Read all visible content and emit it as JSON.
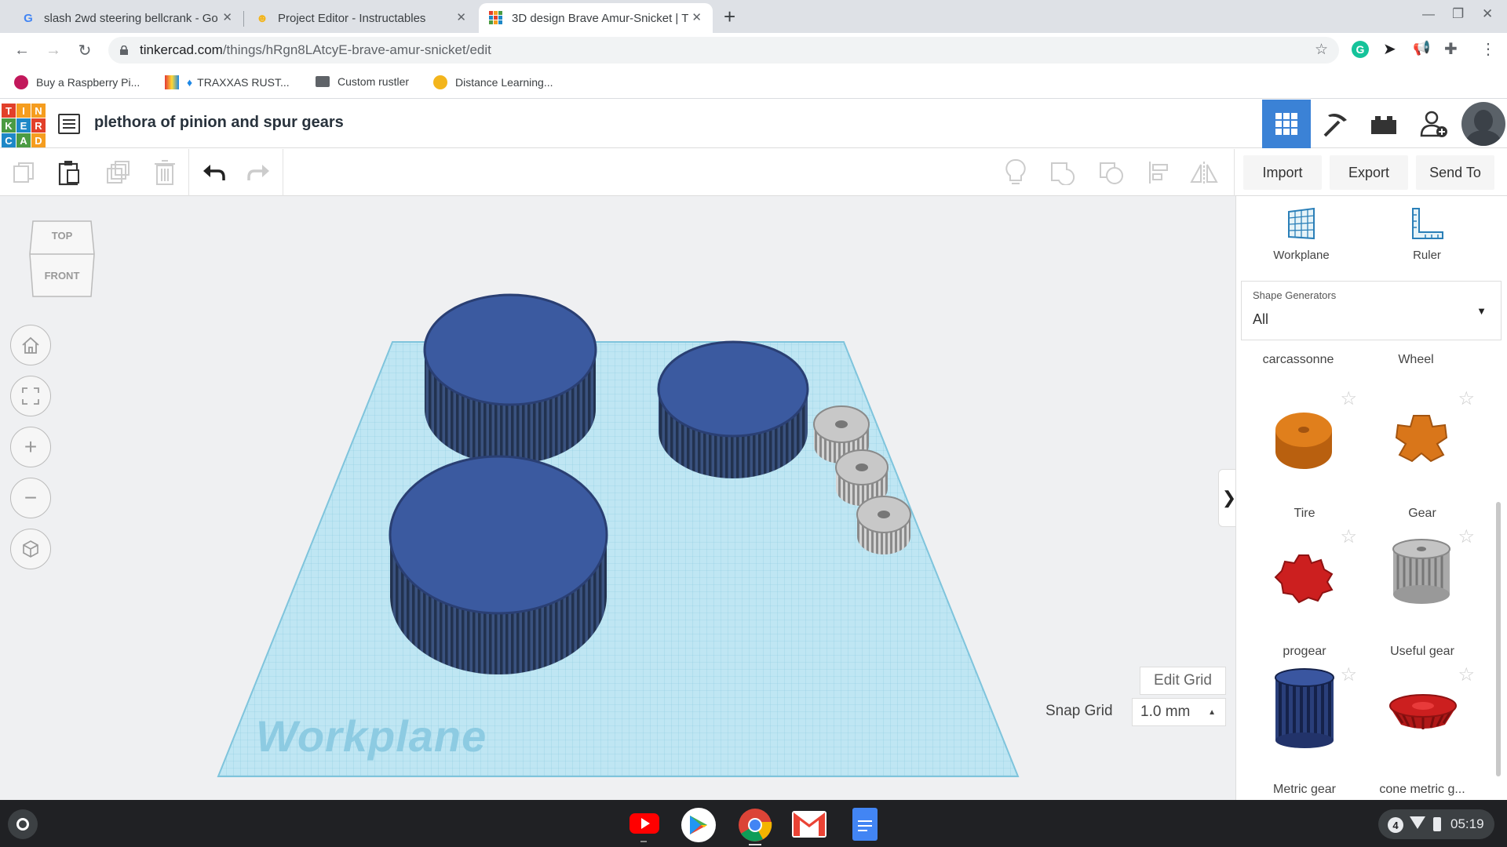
{
  "browser": {
    "tabs": [
      {
        "title": "slash 2wd steering bellcrank - Go",
        "icon": "google-icon"
      },
      {
        "title": "Project Editor - Instructables",
        "icon": "instructables-icon"
      },
      {
        "title": "3D design Brave Amur-Snicket | T",
        "icon": "tinkercad-icon",
        "active": true
      }
    ],
    "new_tab_glyph": "+",
    "url_domain": "tinkercad.com",
    "url_path": "/things/hRgn8LAtcyE-brave-amur-snicket/edit",
    "bookmarks": [
      {
        "label": "Buy a Raspberry Pi..."
      },
      {
        "label": "TRAXXAS RUST..."
      },
      {
        "label": "Custom rustler"
      },
      {
        "label": "Distance Learning..."
      }
    ]
  },
  "app": {
    "logo_letters": [
      "T",
      "I",
      "N",
      "K",
      "E",
      "R",
      "C",
      "A",
      "D"
    ],
    "logo_colors": [
      "#e2402a",
      "#f59d1f",
      "#f59d1f",
      "#4b9b43",
      "#1e88c7",
      "#e2402a",
      "#1e88c7",
      "#4b9b43",
      "#f59d1f"
    ],
    "design_title": "plethora of pinion and spur gears",
    "toolbar": {
      "import_label": "Import",
      "export_label": "Export",
      "send_to_label": "Send To"
    }
  },
  "viewport": {
    "view_cube_top": "TOP",
    "view_cube_front": "FRONT",
    "workplane_watermark": "Workplane",
    "edit_grid_label": "Edit Grid",
    "snap_grid_label": "Snap Grid",
    "snap_grid_value": "1.0 mm",
    "panel_toggle_glyph": "❯"
  },
  "panel": {
    "workplane_label": "Workplane",
    "ruler_label": "Ruler",
    "generators_caption": "Shape Generators",
    "generators_value": "All",
    "top_labels": [
      "carcassonne",
      "Wheel"
    ],
    "shapes": [
      {
        "label": "Tire",
        "color": "#d9761a"
      },
      {
        "label": "Gear",
        "color": "#d9761a"
      },
      {
        "label": "progear",
        "color": "#cc1f1f"
      },
      {
        "label": "Useful gear",
        "color": "#a8a8a8"
      },
      {
        "label": "Metric gear",
        "color": "#283f86"
      },
      {
        "label": "cone metric g...",
        "color": "#cc1f1f"
      }
    ]
  },
  "taskbar": {
    "notification_count": "4",
    "time": "05:19"
  },
  "colors": {
    "accent": "#3b82d6",
    "gear_blue": "#3a5ba0",
    "gear_grey": "#bdbdbd",
    "workplane": "#a9dcee"
  }
}
